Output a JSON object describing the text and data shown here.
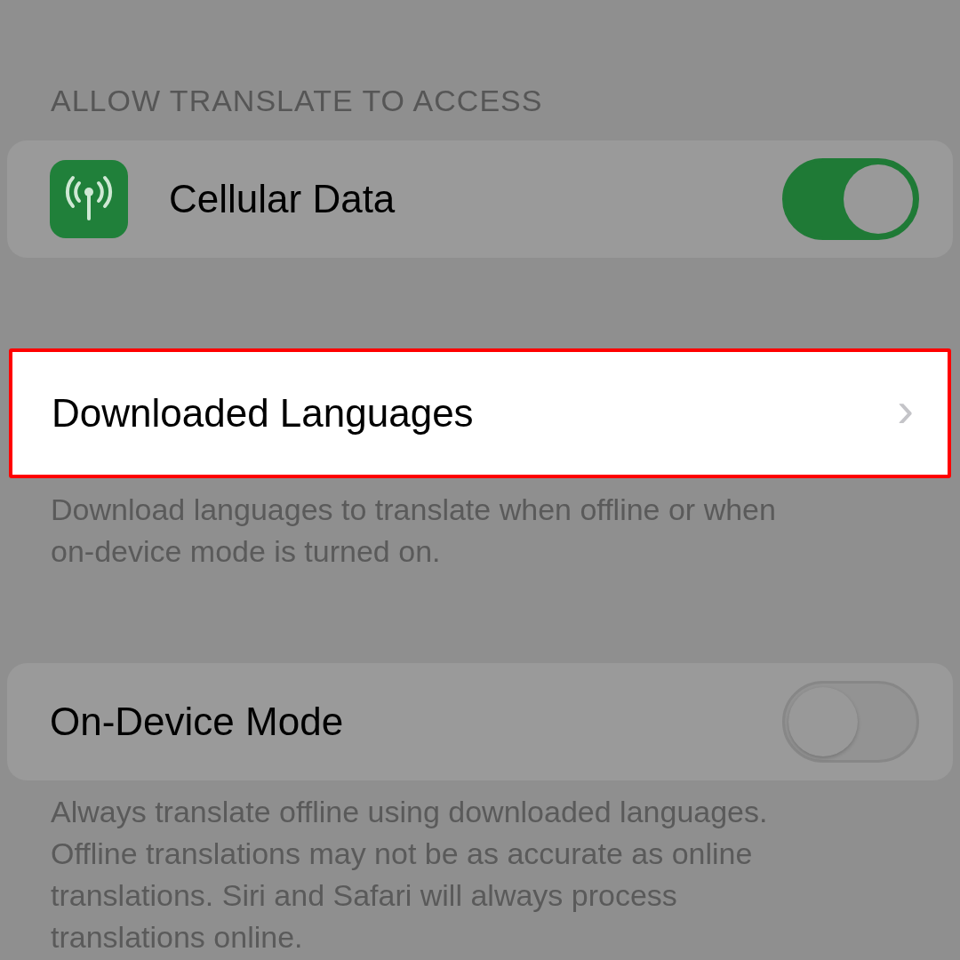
{
  "section_header": "ALLOW TRANSLATE TO ACCESS",
  "groups": [
    {
      "rows": [
        {
          "kind": "toggle",
          "label": "Cellular Data",
          "on": true,
          "highlighted": false
        }
      ]
    },
    {
      "rows": [
        {
          "kind": "link",
          "label": "Downloaded Languages",
          "chevron": "›",
          "highlighted": true
        }
      ],
      "footer": [
        "Download languages to translate when offline or when",
        "on-device mode is turned on."
      ]
    },
    {
      "rows": [
        {
          "kind": "toggle",
          "label": "On-Device Mode",
          "on": false,
          "highlighted": false
        }
      ],
      "footer": [
        "Always translate offline using downloaded languages.",
        "Offline translations may not be as accurate as online",
        "translations. Siri and Safari will always process",
        "translations online."
      ]
    }
  ]
}
